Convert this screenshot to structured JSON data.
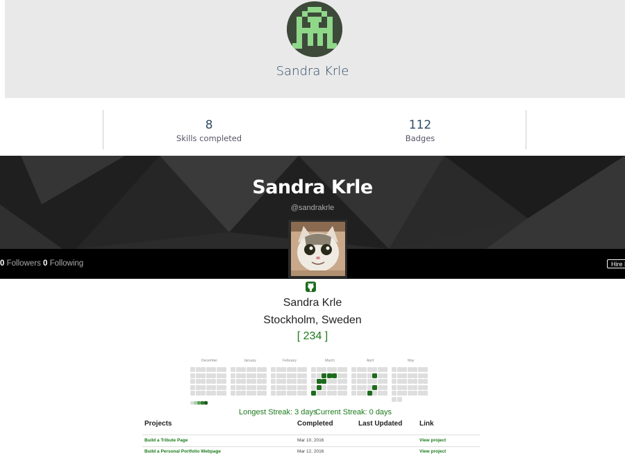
{
  "top_card": {
    "name": "Sandra Krle"
  },
  "stats": [
    {
      "value": "8",
      "label": "Skills completed"
    },
    {
      "value": "112",
      "label": "Badges"
    }
  ],
  "banner": {
    "name": "Sandra Krle",
    "handle": "@sandrakrle"
  },
  "social": {
    "followers_count": "0",
    "followers_label": "Followers",
    "following_count": "0",
    "following_label": "Following",
    "hire_label": "Hire M"
  },
  "profile": {
    "name": "Sandra Krle",
    "location": "Stockholm, Sweden",
    "score": "[ 234 ]"
  },
  "heatmap": {
    "months": [
      "December",
      "January",
      "February",
      "March",
      "April",
      "May"
    ],
    "active_color": "#1e6b1e",
    "empty_color": "#dedede"
  },
  "streaks": {
    "longest": "Longest Streak: 3 days",
    "current": "Current Streak: 0 days"
  },
  "projects": {
    "headers": [
      "Projects",
      "Completed",
      "Last Updated",
      "Link"
    ],
    "rows": [
      {
        "name": "Build a Tribute Page",
        "completed": "Mar 10, 2016",
        "updated": "",
        "link": "View project"
      },
      {
        "name": "Build a Personal Portfolio Webpage",
        "completed": "Mar 12, 2016",
        "updated": "",
        "link": "View project"
      }
    ]
  },
  "colors": {
    "accent_green": "#1a7a1a",
    "title_blue": "#2f4a63",
    "banner_dark": "#2a2a2a"
  }
}
